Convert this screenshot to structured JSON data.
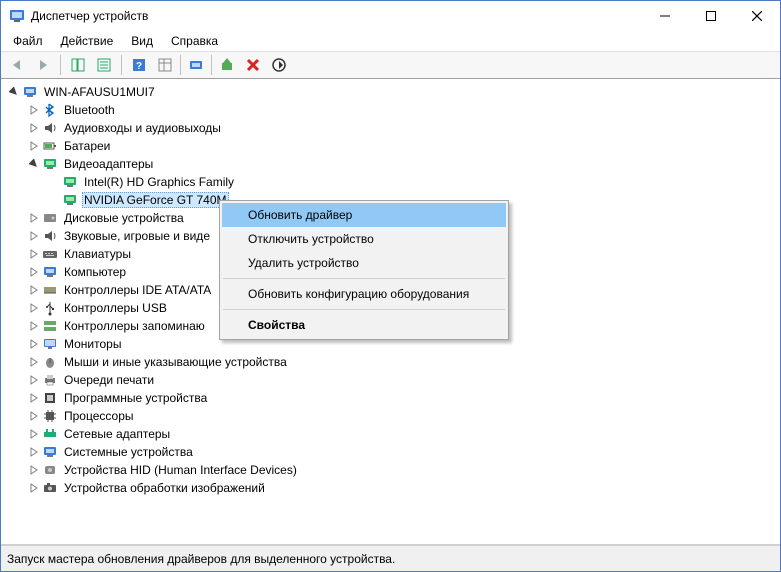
{
  "window": {
    "title": "Диспетчер устройств"
  },
  "menu": {
    "file": "Файл",
    "action": "Действие",
    "view": "Вид",
    "help": "Справка"
  },
  "toolbar": {
    "back": "back",
    "forward": "forward",
    "show_hide_tree": "show-hide-console-tree",
    "properties": "properties",
    "help": "help",
    "details": "details",
    "scan": "scan-hardware",
    "update_driver": "update-driver",
    "uninstall": "uninstall",
    "disable": "disable"
  },
  "tree": {
    "root": "WIN-AFAUSU1MUI7",
    "bluetooth": "Bluetooth",
    "audio": "Аудиовходы и аудиовыходы",
    "batteries": "Батареи",
    "display": "Видеоадаптеры",
    "display_children": {
      "intel": "Intel(R) HD Graphics Family",
      "nvidia": "NVIDIA GeForce GT 740M"
    },
    "disk": "Дисковые устройства",
    "sound": "Звуковые, игровые и виде",
    "keyboards": "Клавиатуры",
    "computer": "Компьютер",
    "ide": "Контроллеры IDE ATA/ATA",
    "usb": "Контроллеры USB",
    "storage": "Контроллеры запоминаю",
    "monitors": "Мониторы",
    "mice": "Мыши и иные указывающие устройства",
    "print_queues": "Очереди печати",
    "software": "Программные устройства",
    "processors": "Процессоры",
    "network": "Сетевые адаптеры",
    "system": "Системные устройства",
    "hid": "Устройства HID (Human Interface Devices)",
    "imaging": "Устройства обработки изображений"
  },
  "context_menu": {
    "update": "Обновить драйвер",
    "disable_dev": "Отключить устройство",
    "uninstall_dev": "Удалить устройство",
    "scan": "Обновить конфигурацию оборудования",
    "properties": "Свойства"
  },
  "statusbar": {
    "text": "Запуск мастера обновления драйверов для выделенного устройства."
  }
}
